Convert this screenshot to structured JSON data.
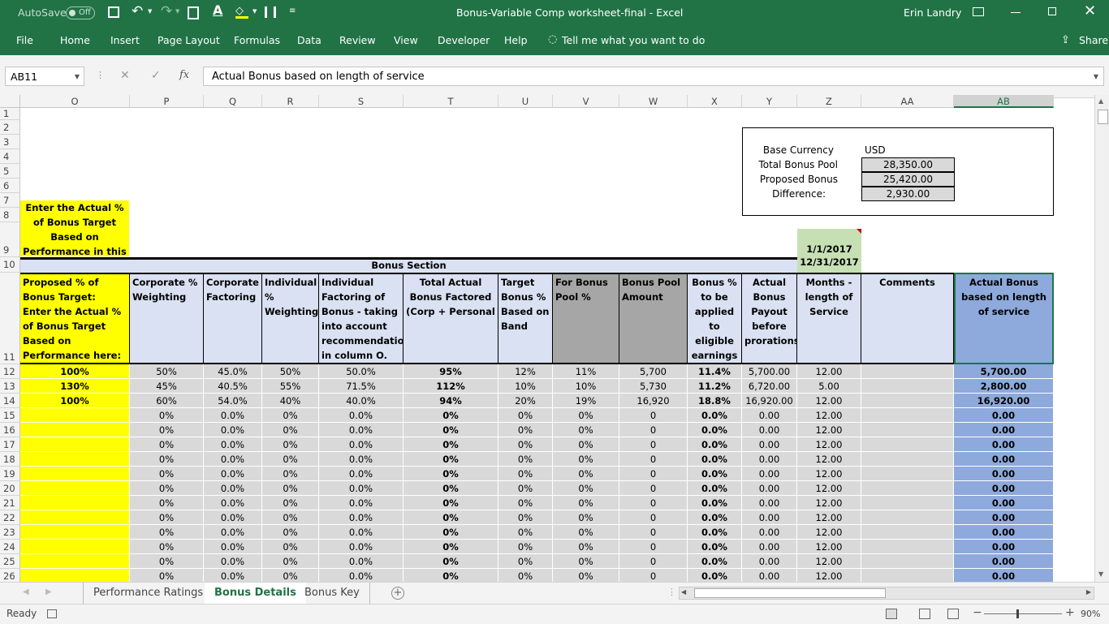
{
  "window": {
    "autosave_label": "AutoSave",
    "autosave_state": "Off",
    "title": "Bonus-Variable Comp worksheet-final  -  Excel",
    "user": "Erin Landry"
  },
  "ribbon": {
    "tabs": [
      "File",
      "Home",
      "Insert",
      "Page Layout",
      "Formulas",
      "Data",
      "Review",
      "View",
      "Developer",
      "Help"
    ],
    "tell_me": "Tell me what you want to do",
    "share": "Share"
  },
  "formula_bar": {
    "name_box": "AB11",
    "fx": "fx",
    "content": "Actual Bonus based on length of service"
  },
  "columns": [
    "O",
    "P",
    "Q",
    "R",
    "S",
    "T",
    "U",
    "V",
    "W",
    "X",
    "Y",
    "Z",
    "AA",
    "AB"
  ],
  "row_numbers": [
    "1",
    "2",
    "3",
    "4",
    "5",
    "6",
    "7",
    "8",
    "9",
    "10",
    "11",
    "12",
    "13",
    "14",
    "15",
    "16",
    "17",
    "18",
    "19",
    "20",
    "21",
    "22",
    "23",
    "24",
    "25",
    "26"
  ],
  "summary": {
    "base_currency_label": "Base Currency",
    "base_currency": "USD",
    "total_pool_label": "Total Bonus Pool",
    "total_pool": "28,350.00",
    "proposed_label": "Proposed Bonus",
    "proposed": "25,420.00",
    "difference_label": "Difference:",
    "difference": "2,930.00"
  },
  "instruction": "Enter the Actual % of Bonus Target Based on Performance in this column",
  "period": {
    "start": "1/1/2017",
    "end": "12/31/2017"
  },
  "section_title": "Bonus Section",
  "headers": [
    "Proposed % of Bonus Target:\nEnter the Actual % of Bonus Target Based on Performance here:",
    "Corporate % Weighting",
    "Corporate Factoring",
    "Individual % Weighting",
    "Individual Factoring of Bonus - taking into account recommendation in column O.",
    "Total Actual Bonus Factored (Corp + Personal",
    "Target Bonus % Based on Band",
    "For Bonus Pool %",
    "Bonus Pool Amount",
    "Bonus % to be applied to eligible earnings",
    "Actual Bonus Payout before prorations",
    "Months - length of Service",
    "Comments",
    "Actual Bonus based on length of service"
  ],
  "rows": [
    [
      "100%",
      "50%",
      "45.0%",
      "50%",
      "50.0%",
      "95%",
      "12%",
      "11%",
      "5,700",
      "11.4%",
      "5,700.00",
      "12.00",
      "",
      "5,700.00"
    ],
    [
      "130%",
      "45%",
      "40.5%",
      "55%",
      "71.5%",
      "112%",
      "10%",
      "10%",
      "5,730",
      "11.2%",
      "6,720.00",
      "5.00",
      "",
      "2,800.00"
    ],
    [
      "100%",
      "60%",
      "54.0%",
      "40%",
      "40.0%",
      "94%",
      "20%",
      "19%",
      "16,920",
      "18.8%",
      "16,920.00",
      "12.00",
      "",
      "16,920.00"
    ],
    [
      "",
      "0%",
      "0.0%",
      "0%",
      "0.0%",
      "0%",
      "0%",
      "0%",
      "0",
      "0.0%",
      "0.00",
      "12.00",
      "",
      "0.00"
    ],
    [
      "",
      "0%",
      "0.0%",
      "0%",
      "0.0%",
      "0%",
      "0%",
      "0%",
      "0",
      "0.0%",
      "0.00",
      "12.00",
      "",
      "0.00"
    ],
    [
      "",
      "0%",
      "0.0%",
      "0%",
      "0.0%",
      "0%",
      "0%",
      "0%",
      "0",
      "0.0%",
      "0.00",
      "12.00",
      "",
      "0.00"
    ],
    [
      "",
      "0%",
      "0.0%",
      "0%",
      "0.0%",
      "0%",
      "0%",
      "0%",
      "0",
      "0.0%",
      "0.00",
      "12.00",
      "",
      "0.00"
    ],
    [
      "",
      "0%",
      "0.0%",
      "0%",
      "0.0%",
      "0%",
      "0%",
      "0%",
      "0",
      "0.0%",
      "0.00",
      "12.00",
      "",
      "0.00"
    ],
    [
      "",
      "0%",
      "0.0%",
      "0%",
      "0.0%",
      "0%",
      "0%",
      "0%",
      "0",
      "0.0%",
      "0.00",
      "12.00",
      "",
      "0.00"
    ],
    [
      "",
      "0%",
      "0.0%",
      "0%",
      "0.0%",
      "0%",
      "0%",
      "0%",
      "0",
      "0.0%",
      "0.00",
      "12.00",
      "",
      "0.00"
    ],
    [
      "",
      "0%",
      "0.0%",
      "0%",
      "0.0%",
      "0%",
      "0%",
      "0%",
      "0",
      "0.0%",
      "0.00",
      "12.00",
      "",
      "0.00"
    ],
    [
      "",
      "0%",
      "0.0%",
      "0%",
      "0.0%",
      "0%",
      "0%",
      "0%",
      "0",
      "0.0%",
      "0.00",
      "12.00",
      "",
      "0.00"
    ],
    [
      "",
      "0%",
      "0.0%",
      "0%",
      "0.0%",
      "0%",
      "0%",
      "0%",
      "0",
      "0.0%",
      "0.00",
      "12.00",
      "",
      "0.00"
    ],
    [
      "",
      "0%",
      "0.0%",
      "0%",
      "0.0%",
      "0%",
      "0%",
      "0%",
      "0",
      "0.0%",
      "0.00",
      "12.00",
      "",
      "0.00"
    ],
    [
      "",
      "0%",
      "0.0%",
      "0%",
      "0.0%",
      "0%",
      "0%",
      "0%",
      "0",
      "0.0%",
      "0.00",
      "12.00",
      "",
      "0.00"
    ]
  ],
  "sheet_tabs": [
    "Performance Ratings",
    "Bonus Details",
    "Bonus Key"
  ],
  "active_sheet": "Bonus Details",
  "status": {
    "ready": "Ready",
    "zoom": "90%"
  },
  "colors": {
    "excel_green": "#217346",
    "header_fill": "#d9e1f2",
    "yellow": "#ffff00",
    "grey_fill": "#a6a6a6",
    "ab_fill": "#8ea9db",
    "date_fill": "#c6e0b4"
  }
}
